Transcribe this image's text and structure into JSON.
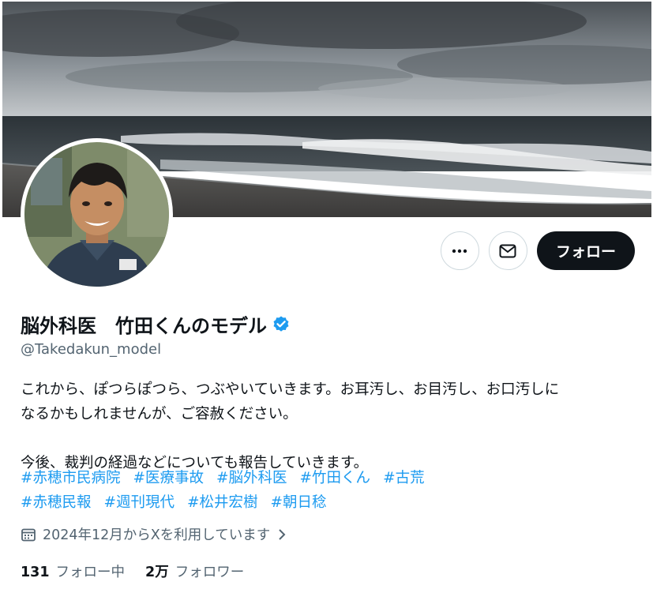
{
  "profile": {
    "display_name": "脳外科医　竹田くんのモデル",
    "handle": "@Takedakun_model",
    "verified": true,
    "verified_color": "#1d9bf0"
  },
  "actions": {
    "more_icon": "more-horizontal-icon",
    "message_icon": "mail-icon",
    "follow_label": "フォロー"
  },
  "bio": {
    "line1": "これから、ぽつらぽつら、つぶやいていきます。お耳汚し、お目汚し、お口汚しに",
    "line2": "なるかもしれませんが、ご容赦ください。",
    "line3": "今後、裁判の経過などについても報告していきます。",
    "hashtags_row1": [
      "#赤穂市民病院",
      "#医療事故",
      "#脳外科医",
      "#竹田くん",
      "#古荒"
    ],
    "hashtags_row2": [
      "#赤穂民報",
      "#週刊現代",
      "#松井宏樹",
      "#朝日稔"
    ],
    "hashtag_color": "#1d9bf0"
  },
  "joined": {
    "icon": "calendar-icon",
    "text": "2024年12月からXを利用しています"
  },
  "stats": {
    "following_count": "131",
    "following_label": "フォロー中",
    "followers_count": "2万",
    "followers_label": "フォロワー"
  }
}
